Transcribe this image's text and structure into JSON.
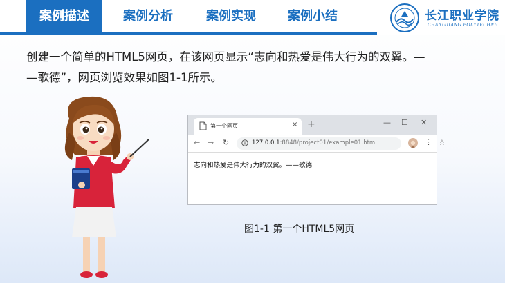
{
  "nav": {
    "tabs": [
      "案例描述",
      "案例分析",
      "案例实现",
      "案例小结"
    ],
    "active_index": 0
  },
  "logo": {
    "name_cn": "长江职业学院",
    "name_en": "CHANGJIANG POLYTECHNIC"
  },
  "description": {
    "line1": "创建一个简单的HTML5网页，在该网页显示“志向和热爱是伟大行为的双翼。—",
    "line2": "—歌德”，网页浏览效果如图1-1所示。"
  },
  "browser": {
    "tab_title": "第一个网页",
    "tab_close": "×",
    "new_tab": "+",
    "url_host": "127.0.0.1",
    "url_rest": ":8848/project01/example01.html",
    "content_text": "志向和热爱是伟大行为的双翼。——歌德",
    "window_min": "—",
    "window_max": "☐",
    "window_close": "✕"
  },
  "figure": {
    "caption": "图1-1 第一个HTML5网页"
  },
  "colors": {
    "brand_blue": "#1b6fc0",
    "shirt_red": "#d8233a"
  }
}
